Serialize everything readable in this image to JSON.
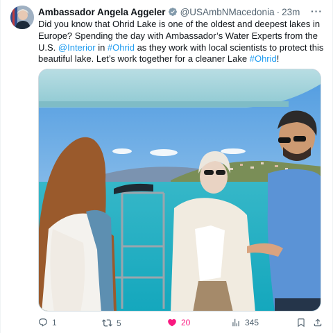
{
  "author": {
    "name": "Ambassador Angela Aggeler",
    "handle": "@USAmbNMacedonia",
    "separator": "·",
    "time": "23m",
    "verified": true
  },
  "tweet": {
    "text_1": "Did you know that Ohrid Lake is one of the oldest and deepest lakes in Europe? Spending the day with Ambassador’s Water Experts from the U.S. ",
    "mention": "@Interior",
    "text_2": " in ",
    "hashtag_1": "#Ohrid",
    "text_3": " as they work with local scientists to protect this beautiful lake. Let’s work together for a cleaner Lake ",
    "hashtag_2": "#Ohrid",
    "text_4": "!"
  },
  "actions": {
    "replies": "1",
    "reposts": "5",
    "likes": "20",
    "views": "345"
  },
  "colors": {
    "link": "#1d9bf0",
    "like": "#f91880",
    "muted": "#536471",
    "verified": "#829aab"
  },
  "icons": {
    "more": "more-icon",
    "reply": "reply-icon",
    "repost": "repost-icon",
    "like": "heart-icon",
    "views": "views-icon",
    "bookmark": "bookmark-icon",
    "share": "share-icon"
  }
}
